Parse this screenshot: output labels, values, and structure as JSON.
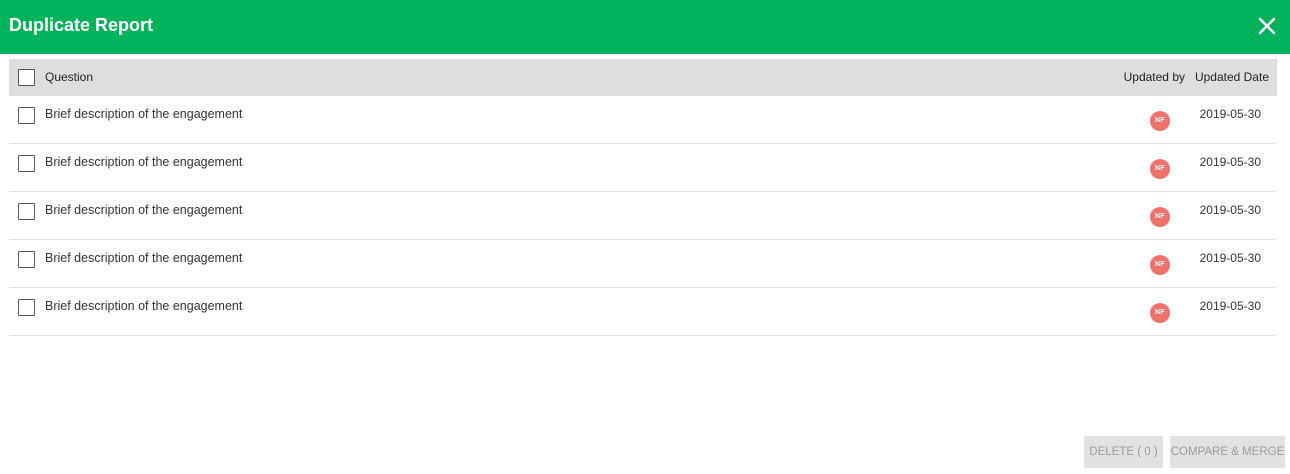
{
  "dialog": {
    "title": "Duplicate Report",
    "header_color": "#00b259",
    "close_icon": "close-icon"
  },
  "table": {
    "headers": {
      "question": "Question",
      "updated_by": "Updated by",
      "updated_date": "Updated Date"
    },
    "rows": [
      {
        "question": "Brief description of the engagement",
        "updated_by": "NF",
        "updated_date": "2019-05-30",
        "checked": false
      },
      {
        "question": "Brief description of the engagement",
        "updated_by": "NF",
        "updated_date": "2019-05-30",
        "checked": false
      },
      {
        "question": "Brief description of the engagement",
        "updated_by": "NF",
        "updated_date": "2019-05-30",
        "checked": false
      },
      {
        "question": "Brief description of the engagement",
        "updated_by": "NF",
        "updated_date": "2019-05-30",
        "checked": false
      },
      {
        "question": "Brief description of the engagement",
        "updated_by": "NF",
        "updated_date": "2019-05-30",
        "checked": false
      }
    ],
    "avatar_color": "#f0706a"
  },
  "footer": {
    "delete_label": "DELETE ( 0 )",
    "merge_label": "COMPARE & MERGE"
  }
}
